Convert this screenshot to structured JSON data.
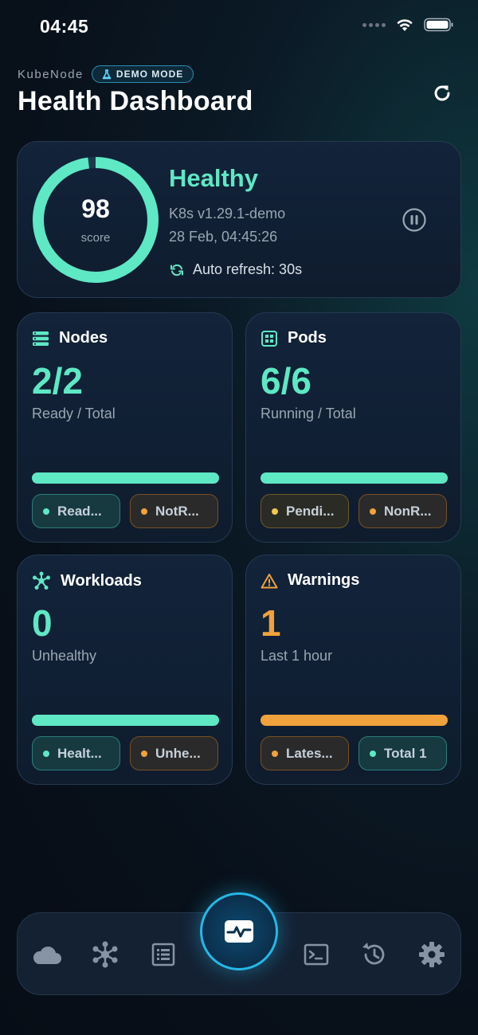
{
  "status_bar": {
    "time": "04:45"
  },
  "header": {
    "brand": "KubeNode",
    "badge": "DEMO MODE",
    "title": "Health Dashboard"
  },
  "health": {
    "score": "98",
    "score_label": "score",
    "score_fraction": 0.98,
    "status": "Healthy",
    "version": "K8s v1.29.1-demo",
    "timestamp": "28 Feb, 04:45:26",
    "auto_refresh": "Auto refresh: 30s"
  },
  "cards": {
    "nodes": {
      "title": "Nodes",
      "value": "2/2",
      "subtitle": "Ready / Total",
      "chips": [
        "Read...",
        "NotR..."
      ]
    },
    "pods": {
      "title": "Pods",
      "value": "6/6",
      "subtitle": "Running / Total",
      "chips": [
        "Pendi...",
        "NonR..."
      ]
    },
    "workloads": {
      "title": "Workloads",
      "value": "0",
      "subtitle": "Unhealthy",
      "chips": [
        "Healt...",
        "Unhe..."
      ]
    },
    "warnings": {
      "title": "Warnings",
      "value": "1",
      "subtitle": "Last 1 hour",
      "chips": [
        "Lates...",
        "Total 1"
      ]
    }
  },
  "colors": {
    "teal": "#5ee8c4",
    "orange": "#f0a23c",
    "amber": "#f2c94c",
    "accent": "#25b8e8"
  },
  "nav": {
    "items": [
      "cloud-icon",
      "cluster-icon",
      "list-icon",
      "health-icon",
      "terminal-icon",
      "history-icon",
      "settings-icon"
    ],
    "active": "health-icon"
  }
}
